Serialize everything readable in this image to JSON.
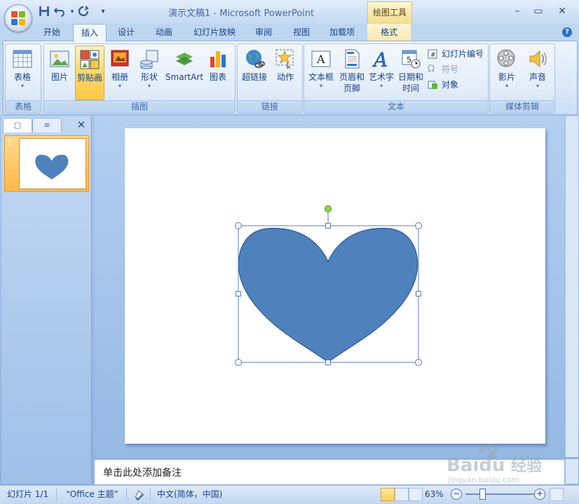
{
  "window": {
    "title": "演示文稿1 - Microsoft PowerPoint",
    "contextual_tab_header": "绘图工具",
    "minimize_glyph": "–",
    "maximize_glyph": "▭",
    "close_glyph": "✕"
  },
  "quick_access": {
    "save_icon": "save-icon",
    "undo_icon": "undo-icon",
    "redo_icon": "redo-icon",
    "customize_glyph": "▾"
  },
  "tabs": [
    {
      "label": "开始"
    },
    {
      "label": "插入",
      "active": true
    },
    {
      "label": "设计"
    },
    {
      "label": "动画"
    },
    {
      "label": "幻灯片放映"
    },
    {
      "label": "审阅"
    },
    {
      "label": "视图"
    },
    {
      "label": "加载项"
    },
    {
      "label": "格式"
    }
  ],
  "help_glyph": "?",
  "ribbon": {
    "groups": {
      "tables": {
        "label": "表格",
        "table_btn": "表格"
      },
      "illustrations": {
        "label": "插图",
        "picture_btn": "图片",
        "clipart_btn": "剪贴画",
        "album_btn": "相册",
        "shapes_btn": "形状",
        "smartart_btn": "SmartArt",
        "chart_btn": "图表"
      },
      "links": {
        "label": "链接",
        "hyperlink_btn": "超链接",
        "action_btn": "动作"
      },
      "text": {
        "label": "文本",
        "textbox_btn": "文本框",
        "header_btn_l1": "页眉和",
        "header_btn_l2": "页脚",
        "wordart_btn": "艺术字",
        "datetime_btn_l1": "日期和",
        "datetime_btn_l2": "时间",
        "slide_number": "幻灯片编号",
        "symbol": "符号",
        "object": "对象"
      },
      "media": {
        "label": "媒体剪辑",
        "movie_btn": "影片",
        "sound_btn": "声音"
      }
    }
  },
  "slides_pane": {
    "tab_slides_icon": "slides-tab-icon",
    "tab_outline_icon": "outline-tab-icon",
    "close_glyph": "✕",
    "thumbnail_number": "1"
  },
  "notes": {
    "placeholder": "单击此处添加备注"
  },
  "status": {
    "slide_info": "幻灯片 1/1",
    "theme": "“Office 主题”",
    "language": "中文(简体，中国)",
    "zoom": "63%"
  },
  "colors": {
    "heart_fill": "#4f81bd",
    "heart_stroke": "#3a659c",
    "rotation_handle": "#8cd64a"
  },
  "watermark": {
    "brand": "Baidu",
    "brand_cn": "经验",
    "url": "jingyan.baidu.com"
  }
}
